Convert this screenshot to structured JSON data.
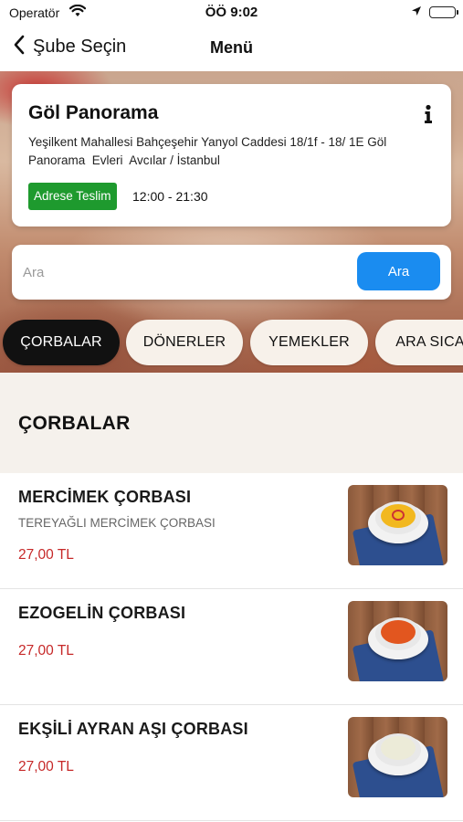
{
  "status_bar": {
    "carrier": "Operatör",
    "time": "ÖÖ 9:02"
  },
  "nav": {
    "back_label": "Şube Seçin",
    "title": "Menü"
  },
  "branch": {
    "name": "Göl Panorama",
    "address": "Yeşilkent Mahallesi Bahçeşehir Yanyol Caddesi 18/1f - 18/ 1E Göl Panorama  Evleri  Avcılar / İstanbul",
    "delivery_label": "Adrese Teslim",
    "hours": "12:00 - 21:30"
  },
  "search": {
    "placeholder": "Ara",
    "value": "",
    "button_label": "Ara"
  },
  "categories": [
    {
      "label": "ÇORBALAR",
      "active": true
    },
    {
      "label": "DÖNERLER",
      "active": false
    },
    {
      "label": "YEMEKLER",
      "active": false
    },
    {
      "label": "ARA SICA",
      "active": false
    }
  ],
  "section": {
    "title": "ÇORBALAR"
  },
  "products": [
    {
      "name": "MERCİMEK ÇORBASI",
      "description": "TEREYAĞLI MERCİMEK ÇORBASI",
      "price": "27,00 TL",
      "soup_color": "#f2b81f"
    },
    {
      "name": "EZOGELİN ÇORBASI",
      "description": "",
      "price": "27,00 TL",
      "soup_color": "#e2561f"
    },
    {
      "name": "EKŞİLİ AYRAN AŞI ÇORBASI",
      "description": "",
      "price": "27,00 TL",
      "soup_color": "#ecebd8"
    }
  ],
  "colors": {
    "accent_blue": "#1a8cf0",
    "delivery_green": "#1e9a2e",
    "price_red": "#c62828",
    "active_tab": "#111111"
  },
  "icons": {
    "back": "chevron-left-icon",
    "info": "info-icon",
    "wifi": "wifi-icon",
    "location": "location-arrow-icon",
    "battery": "battery-icon"
  }
}
